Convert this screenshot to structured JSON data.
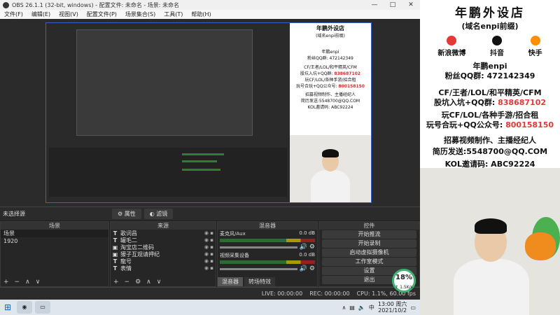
{
  "window": {
    "title": "OBS 26.1.1 (32-bit, windows) - 配置文件: 未命名 - 场景: 未命名",
    "controls": [
      "—",
      "□",
      "✕"
    ]
  },
  "menu": [
    "文件(F)",
    "编辑(E)",
    "视图(V)",
    "配置文件(P)",
    "场景集合(S)",
    "工具(T)",
    "帮助(H)"
  ],
  "dock": {
    "no_source": "未选择源",
    "properties_btn": "属性",
    "filters_btn": "滤镜"
  },
  "scenes": {
    "header": "场景",
    "items": [
      "场景",
      "1920"
    ]
  },
  "sources": {
    "header": "来源",
    "items": [
      {
        "icon": "T",
        "name": "歌词昌"
      },
      {
        "icon": "T",
        "name": "罐毛二"
      },
      {
        "icon": "▣",
        "name": "淘宝店二维码"
      },
      {
        "icon": "▣",
        "name": "獴子互观请押纪"
      },
      {
        "icon": "T",
        "name": "龍号"
      },
      {
        "icon": "T",
        "name": "表情"
      }
    ]
  },
  "mixer": {
    "header": "混音器",
    "channels": [
      {
        "name": "麦克风/Aux",
        "db": "0.0 dB"
      },
      {
        "name": "视频采集设备",
        "db": "0.0 dB"
      }
    ],
    "tabs": [
      "混音器",
      "转场特效"
    ]
  },
  "controls": {
    "header": "控件",
    "buttons": [
      "开始推流",
      "开始录制",
      "启动虚拟摄像机",
      "工作室模式",
      "设置",
      "退出"
    ]
  },
  "status": {
    "live": "LIVE: 00:00:00",
    "rec": "REC: 00:00:00",
    "cpu": "CPU: 1.1%, 60.00 fps"
  },
  "badge": {
    "value": "18%",
    "sub": "↑ 1.5K/s"
  },
  "taskbar": {
    "time": "13:00 周六",
    "date": "2021/10/2",
    "lang": "中"
  },
  "overlay": {
    "title": "年鹏外设店",
    "subtitle": "(域名enpi前缀)",
    "socials": [
      "新浪微博",
      "抖音",
      "快手"
    ],
    "name": "年鹏enpi",
    "fans_group": "粉丝QQ群: 472142349",
    "line_cf": "CF/王者/LOL/和平精英/CFM",
    "line_cf2_pre": "股坑入坑+QQ群: ",
    "line_cf2_num": "838687102",
    "line_game": "玩CF/LOL/各种手游/招合租",
    "line_game2_pre": "玩号合玩+QQ公众号: ",
    "line_game2_num": "800158150",
    "recruit": "招募视频制作、主播经纪人",
    "resume": "简历发送:5548700@QQ.COM",
    "kol": "KOL邀请码: ABC92224"
  },
  "colors": {
    "accent": "#3a5fcc",
    "highlight_red": "#e53935",
    "badge_ring": "#3cb371"
  }
}
